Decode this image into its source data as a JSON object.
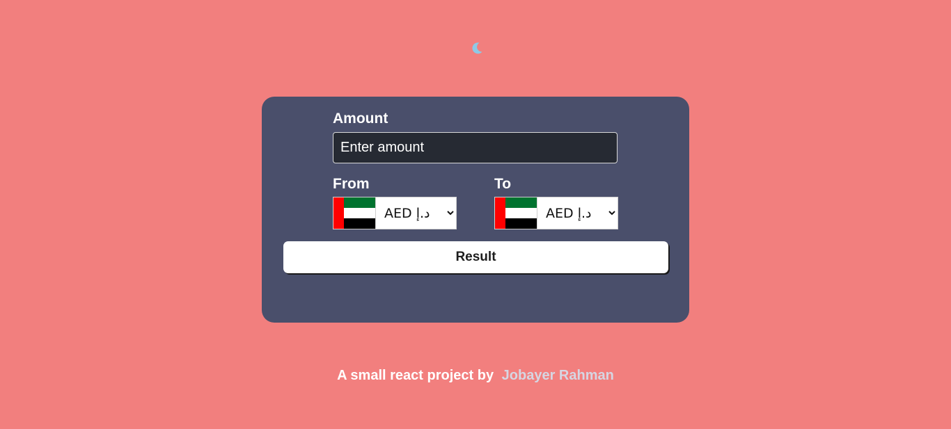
{
  "theme_toggle": {
    "icon": "moon-icon",
    "color": "#8ec9e6"
  },
  "form": {
    "amount_label": "Amount",
    "amount_placeholder": "Enter amount",
    "amount_value": "",
    "from_label": "From",
    "to_label": "To",
    "from_currency": {
      "code": "AED",
      "display": "AED د.إ",
      "flag": "uae-flag-icon"
    },
    "to_currency": {
      "code": "AED",
      "display": "AED د.إ",
      "flag": "uae-flag-icon"
    },
    "result_label": "Result"
  },
  "footer": {
    "text": "A small react project by",
    "author": "Jobayer Rahman"
  },
  "colors": {
    "background": "#f27f7e",
    "card": "#4a4f6b",
    "input": "#262a33"
  }
}
